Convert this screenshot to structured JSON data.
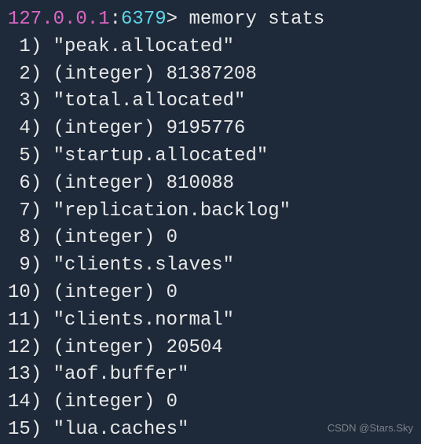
{
  "prompt": {
    "host": "127.0.0.1",
    "port": "6379",
    "separator": ":",
    "suffix": "> ",
    "command": "memory stats"
  },
  "rows": [
    {
      "index": "1",
      "value": "\"peak.allocated\""
    },
    {
      "index": "2",
      "value": "(integer) 81387208"
    },
    {
      "index": "3",
      "value": "\"total.allocated\""
    },
    {
      "index": "4",
      "value": "(integer) 9195776"
    },
    {
      "index": "5",
      "value": "\"startup.allocated\""
    },
    {
      "index": "6",
      "value": "(integer) 810088"
    },
    {
      "index": "7",
      "value": "\"replication.backlog\""
    },
    {
      "index": "8",
      "value": "(integer) 0"
    },
    {
      "index": "9",
      "value": "\"clients.slaves\""
    },
    {
      "index": "10",
      "value": "(integer) 0"
    },
    {
      "index": "11",
      "value": "\"clients.normal\""
    },
    {
      "index": "12",
      "value": "(integer) 20504"
    },
    {
      "index": "13",
      "value": "\"aof.buffer\""
    },
    {
      "index": "14",
      "value": "(integer) 0"
    },
    {
      "index": "15",
      "value": "\"lua.caches\""
    }
  ],
  "watermark": "CSDN @Stars.Sky"
}
